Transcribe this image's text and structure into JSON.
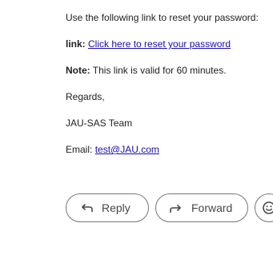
{
  "email": {
    "reset_intro": "Use the following link to reset your password:",
    "link_label": "link:",
    "link_text": "Click here to reset your password",
    "note_label": "Note:",
    "note_text": "This link is valid for 60 minutes.",
    "regards": "Regards,",
    "signature": "JAU-SAS Team",
    "email_label": "Email:",
    "email_address": "test@JAU.com"
  },
  "actions": {
    "reply_label": "Reply",
    "forward_label": "Forward"
  },
  "icons": {
    "reply": "reply-arrow-icon",
    "forward": "forward-arrow-icon",
    "emoji": "smiley-emoji-icon"
  },
  "colors": {
    "link": "#1a0dab",
    "text": "#202124",
    "button_border": "#747775"
  }
}
